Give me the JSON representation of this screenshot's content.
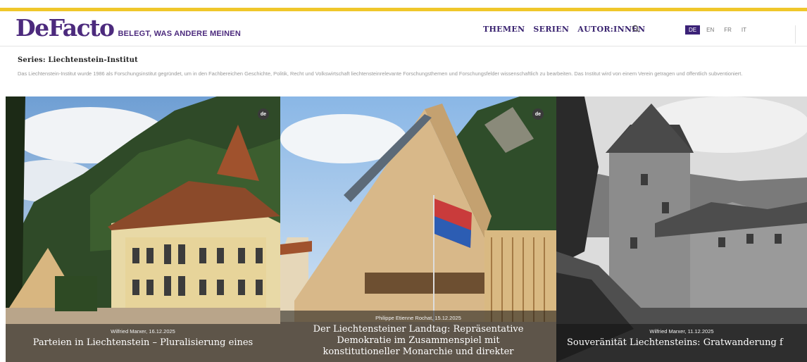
{
  "header": {
    "logo": "DeFacto",
    "tagline": "BELEGT, WAS ANDERE MEINEN",
    "nav": [
      "THEMEN",
      "SERIEN",
      "AUTOR:INNEN"
    ],
    "languages": [
      "DE",
      "EN",
      "FR",
      "IT"
    ],
    "active_language": "DE",
    "accent_color": "#4c2a7d",
    "topbar_color": "#f0c72b"
  },
  "series": {
    "title": "Series: Liechtenstein-Institut",
    "description": "Das Liechtenstein-Institut wurde 1986 als Forschungsinstitut gegründet, um in den Fachbereichen Geschichte, Politik, Recht und Volkswirtschaft liechtensteinrelevante Forschungsthemen und Forschungsfelder wissenschaftlich zu bearbeiten. Das Institut wird von einem Verein getragen und öffentlich subventioniert."
  },
  "cards": [
    {
      "badge": "de",
      "meta": "Wilfried Marxer, 16.12.2025",
      "title_lines": [
        "Parteien in Liechtenstein – Pluralisierung eines"
      ],
      "image": "government-building-photo"
    },
    {
      "badge": "de",
      "meta": "Philippe Etienne Rochat, 15.12.2025",
      "title_lines": [
        "Der Liechtensteiner Landtag: Repräsentative",
        "Demokratie im Zusammenspiel mit",
        "konstitutioneller Monarchie und direkter"
      ],
      "image": "parliament-building-photo"
    },
    {
      "badge": "",
      "meta": "Wilfried Marxer, 11.12.2025",
      "title_lines": [
        "Souveränität Liechtensteins: Gratwanderung f"
      ],
      "image": "castle-photo"
    }
  ]
}
